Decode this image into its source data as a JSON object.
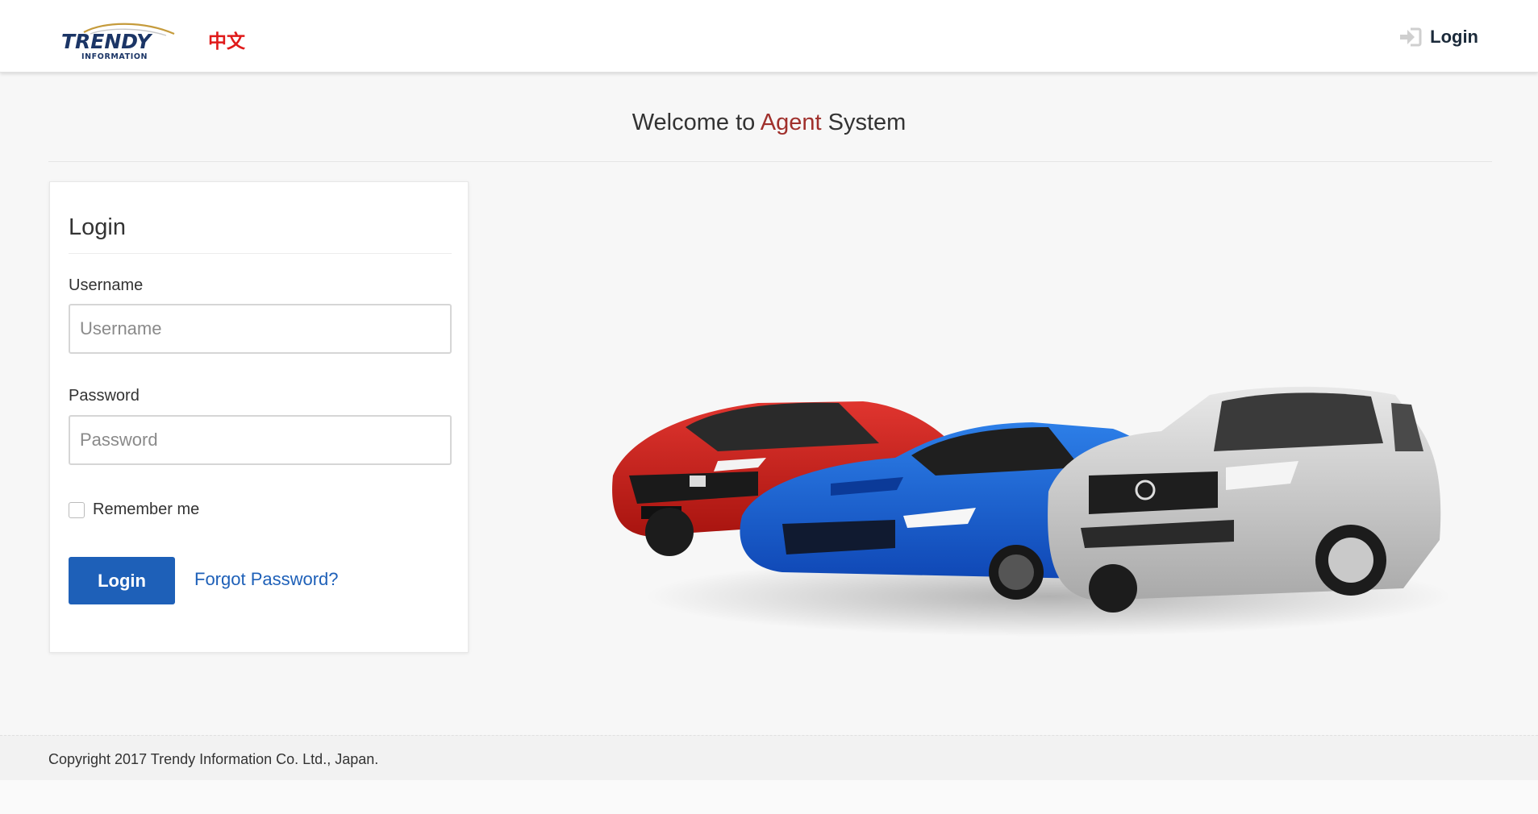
{
  "navbar": {
    "logo_text": "TRENDY",
    "logo_subtext": "INFORMATION",
    "language_link": "中文",
    "login_label": "Login",
    "login_icon": "sign-in-icon"
  },
  "welcome": {
    "prefix": "Welcome to ",
    "accent": "Agent",
    "suffix": " System",
    "accent_color": "#a0302c"
  },
  "login_panel": {
    "title": "Login",
    "username_label": "Username",
    "username_placeholder": "Username",
    "username_value": "",
    "password_label": "Password",
    "password_placeholder": "Password",
    "password_value": "",
    "remember_label": "Remember me",
    "remember_checked": false,
    "submit_label": "Login",
    "forgot_label": "Forgot Password?"
  },
  "hero": {
    "image_description": "cars-lineup-image",
    "cars": [
      "red-hatchback",
      "blue-sedan",
      "silver-suv"
    ]
  },
  "footer": {
    "copyright": "Copyright 2017 Trendy Information Co. Ltd., Japan."
  },
  "colors": {
    "primary": "#1e60b8",
    "language_link": "#e01a1a",
    "logo_navy": "#1b3566",
    "logo_gold": "#c59b3c"
  }
}
